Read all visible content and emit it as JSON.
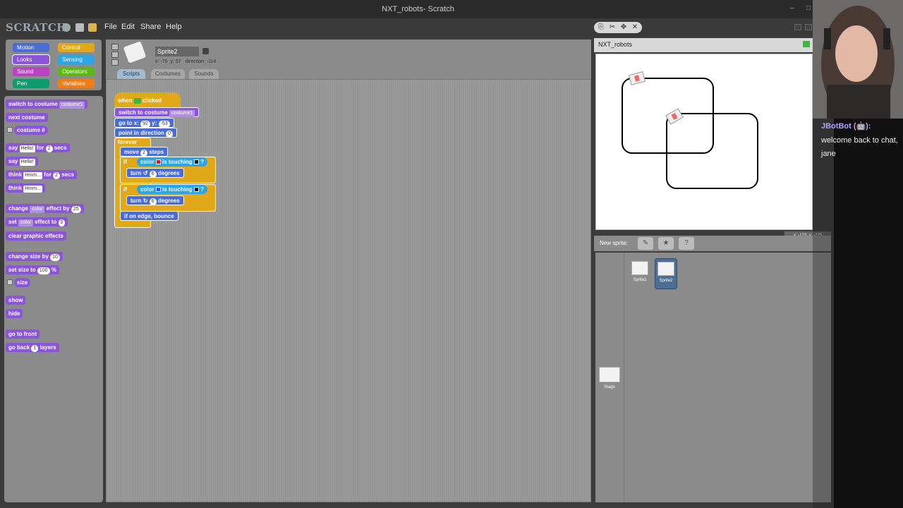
{
  "window": {
    "title": "NXT_robots- Scratch"
  },
  "menu": {
    "logo": "SCRATCH",
    "items": [
      "File",
      "Edit",
      "Share",
      "Help"
    ]
  },
  "categories": [
    {
      "label": "Motion",
      "color": "#4a6cd4"
    },
    {
      "label": "Control",
      "color": "#e1a91a"
    },
    {
      "label": "Looks",
      "color": "#8a55d7"
    },
    {
      "label": "Sensing",
      "color": "#2ca5e2"
    },
    {
      "label": "Sound",
      "color": "#bb42c3"
    },
    {
      "label": "Operators",
      "color": "#5cb712"
    },
    {
      "label": "Pen",
      "color": "#0e9a6c"
    },
    {
      "label": "Variables",
      "color": "#ee7d16"
    }
  ],
  "palette": {
    "switch_costume": "switch to costume",
    "costume_value": "costume1",
    "next_costume": "next costume",
    "costume_num": "costume #",
    "say": "say",
    "say_hello": "Hello!",
    "for": "for",
    "secs": "secs",
    "num2": "2",
    "think": "think",
    "think_hmm": "Hmm...",
    "change": "change",
    "color": "color",
    "effect_by": "effect by",
    "num25": "25",
    "set": "set",
    "effect_to": "effect to",
    "num0": "0",
    "clear_effects": "clear graphic effects",
    "change_size_by": "change size by",
    "num10": "10",
    "set_size_to": "set size to",
    "num100": "100",
    "pct": "%",
    "size": "size",
    "show": "show",
    "hide": "hide",
    "go_front": "go to front",
    "go_back": "go back",
    "num1": "1",
    "layers": "layers"
  },
  "sprite": {
    "name": "Sprite2",
    "x_label": "x:",
    "x": "-75",
    "y_label": "y:",
    "y": "57",
    "dir_label": "direction:",
    "direction": "-114"
  },
  "tabs": [
    "Scripts",
    "Costumes",
    "Sounds"
  ],
  "script": {
    "when": "when",
    "clicked": "clicked",
    "switch_costume": "switch to costume",
    "costume1": "costume1",
    "goto": "go to x:",
    "x": "92",
    "y_label": "y:",
    "y": "-53",
    "point_dir": "point in direction",
    "dir": "0",
    "forever": "forever",
    "move": "move",
    "move_n": "2",
    "steps": "steps",
    "if": "if",
    "color": "color",
    "is_touching": "is touching",
    "q": "?",
    "turn": "turn",
    "turn_n": "6",
    "degrees": "degrees",
    "bounce": "if on edge, bounce"
  },
  "stage": {
    "title": "NXT_robots",
    "xy_x_label": "x:",
    "xy_x": "-123",
    "xy_y_label": "y:",
    "xy_y": "-225"
  },
  "library": {
    "new_sprite": "New sprite:",
    "sprites": [
      "Sprite1",
      "Sprite2"
    ],
    "stage_label": "Stage"
  },
  "chat": {
    "user": "JBotBot (🤖):",
    "message": "welcome back to chat, jane"
  },
  "colors": {
    "looks": "#8a55d7",
    "control": "#e1a91a",
    "motion": "#4a6cd4",
    "sensing": "#2ca5e2",
    "red_sensor": "#e81010",
    "blue_sensor": "#2b55e8"
  }
}
